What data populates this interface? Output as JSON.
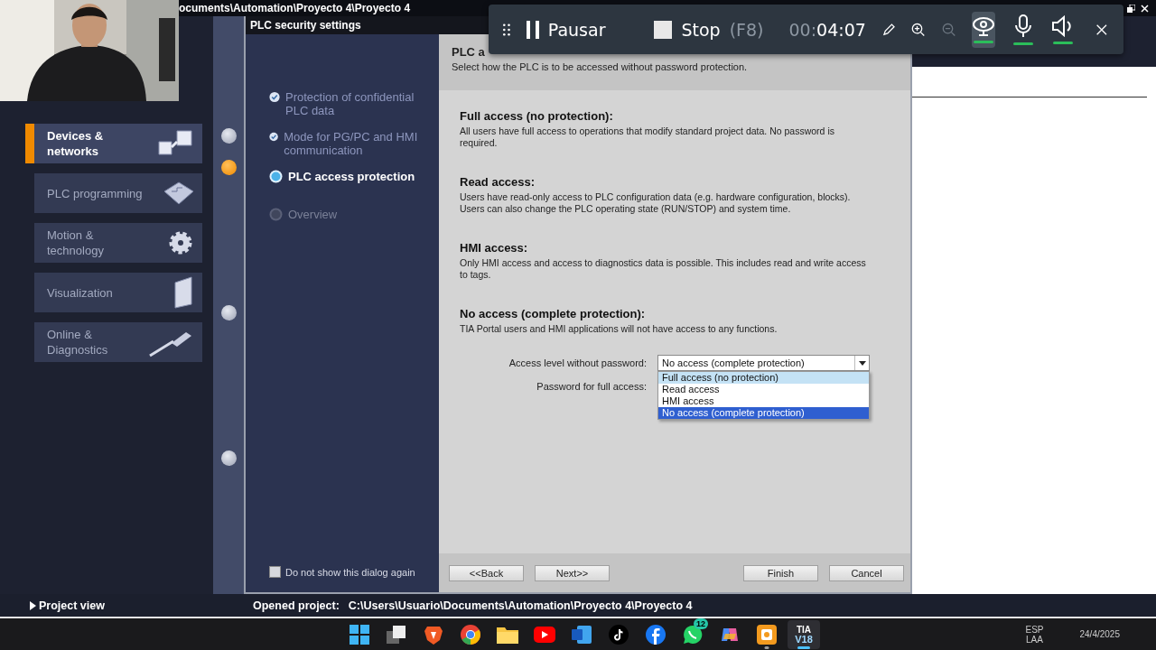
{
  "title_bar": {
    "path": "ocuments\\Automation\\Proyecto 4\\Proyecto 4"
  },
  "portal_nav": {
    "items": [
      {
        "label": "Devices & networks",
        "kind": "devices",
        "selected": true
      },
      {
        "label": "PLC programming",
        "kind": "plc",
        "selected": false
      },
      {
        "label": "Motion & technology",
        "kind": "motion",
        "selected": false
      },
      {
        "label": "Visualization",
        "kind": "visualization",
        "selected": false
      },
      {
        "label": "Online & Diagnostics",
        "kind": "online",
        "selected": false
      }
    ]
  },
  "progress_dots": [
    {
      "selected": false
    },
    {
      "selected": true
    },
    {
      "selected": false
    },
    {
      "selected": false
    }
  ],
  "dialog": {
    "title": "PLC security settings",
    "steps": [
      {
        "label": "Protection of confidential PLC data",
        "completed": true,
        "selected": false
      },
      {
        "label": "Mode for PG/PC and HMI communication",
        "completed": true,
        "selected": false
      },
      {
        "label": "PLC access protection",
        "completed": false,
        "selected": true
      },
      {
        "label": "Overview",
        "completed": false,
        "selected": false
      }
    ],
    "dont_show_again": {
      "label": "Do not show this dialog again",
      "checked": false
    },
    "header": {
      "title": "PLC a",
      "subtitle": "Select how the PLC is to be accessed without password protection."
    },
    "sections": [
      {
        "heading": "Full access (no protection):",
        "text": "All users have full access to operations that modify standard project data. No password is required."
      },
      {
        "heading": "Read access:",
        "text": "Users have read-only access to PLC configuration data (e.g. hardware configuration, blocks). Users can also change the PLC operating state (RUN/STOP) and system time."
      },
      {
        "heading": "HMI access:",
        "text": "Only HMI access and access to diagnostics data is possible. This includes read and write access to tags."
      },
      {
        "heading": "No access (complete protection):",
        "text": "TIA Portal users and HMI applications will not have access to any functions."
      }
    ],
    "access_level": {
      "label": "Access level without password:",
      "value": "No access (complete protection)",
      "expanded": true,
      "options": [
        {
          "label": "Full access (no protection)",
          "selected": false,
          "hovered": true
        },
        {
          "label": "Read access",
          "selected": false,
          "hovered": false
        },
        {
          "label": "HMI access",
          "selected": false,
          "hovered": false
        },
        {
          "label": "No access (complete protection)",
          "selected": true,
          "hovered": false
        }
      ]
    },
    "password_label": "Password for full access:",
    "buttons": [
      {
        "label": "<<Back",
        "kind": "nav"
      },
      {
        "label": "Next>>",
        "kind": "nav"
      },
      {
        "label": "Finish",
        "kind": "action"
      },
      {
        "label": "Cancel",
        "kind": "action"
      }
    ]
  },
  "status_bar": {
    "project_view": "Project view",
    "opened_label": "Opened project:",
    "opened_path": "C:\\Users\\Usuario\\Documents\\Automation\\Proyecto 4\\Proyecto 4"
  },
  "recorder": {
    "pause": "Pausar",
    "stop": "Stop",
    "stop_key": "(F8)",
    "time_prefix": "00:",
    "time": "04:07",
    "toggles": [
      {
        "kind": "webcam",
        "on": true
      },
      {
        "kind": "mic",
        "on": true
      },
      {
        "kind": "speaker",
        "on": true
      }
    ]
  },
  "taskbar": {
    "apps": [
      {
        "kind": "start",
        "running": false,
        "active": false
      },
      {
        "kind": "taskview",
        "running": false,
        "active": false
      },
      {
        "kind": "brave",
        "running": false,
        "active": false
      },
      {
        "kind": "chrome",
        "running": false,
        "active": false
      },
      {
        "kind": "folder",
        "running": false,
        "active": false
      },
      {
        "kind": "youtube",
        "running": false,
        "active": false
      },
      {
        "kind": "word",
        "running": false,
        "active": false
      },
      {
        "kind": "tiktok",
        "running": false,
        "active": false
      },
      {
        "kind": "facebook",
        "running": false,
        "active": false
      },
      {
        "kind": "whatsapp",
        "running": false,
        "active": false,
        "badge": "12"
      },
      {
        "kind": "copilot",
        "running": false,
        "active": false
      },
      {
        "kind": "recorder",
        "running": true,
        "active": false
      },
      {
        "kind": "tia",
        "running": true,
        "active": true,
        "line1": "TIA",
        "line2": "V18"
      }
    ],
    "tray": {
      "lang1": "ESP",
      "lang2": "LAA",
      "date": "24/4/2025"
    }
  }
}
